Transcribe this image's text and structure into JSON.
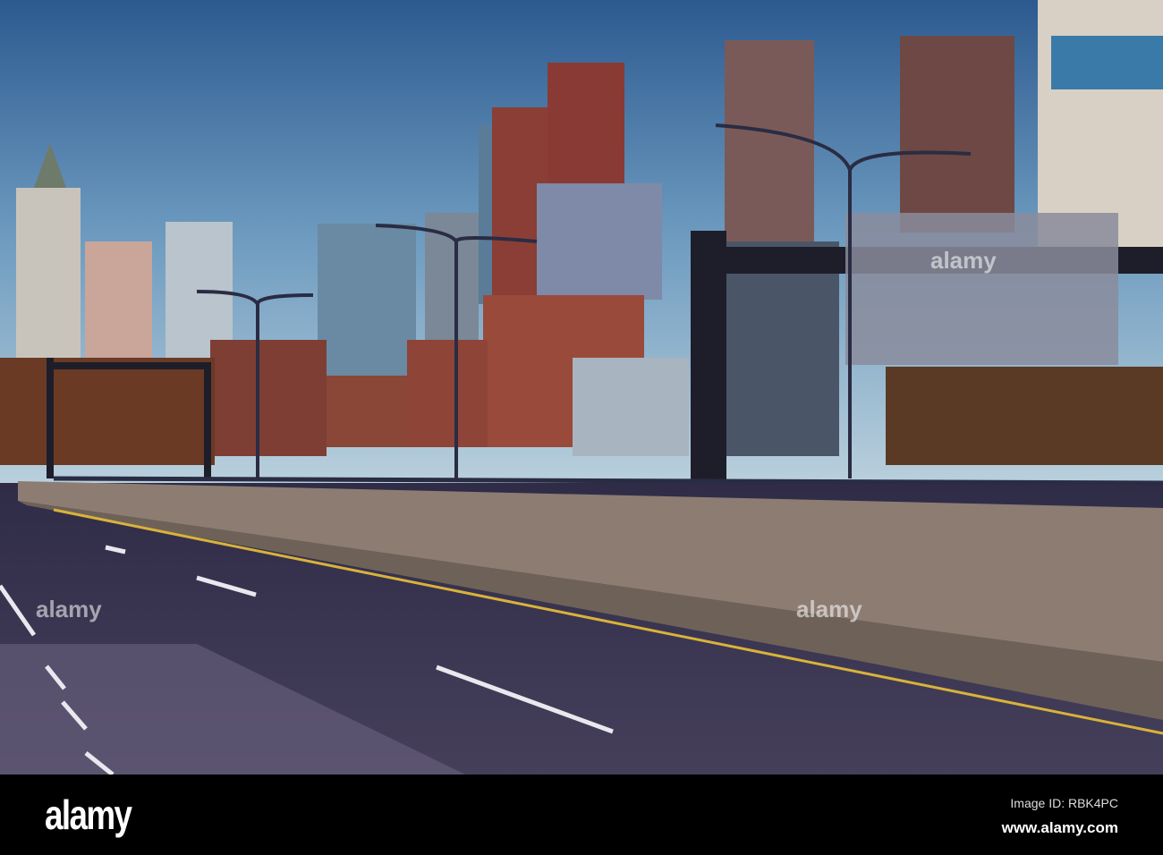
{
  "photo": {
    "subject": "city-skyline-road",
    "colors": {
      "sky_top": "#2f5f94",
      "sky_low": "#a9c4d8",
      "brick": "#9a4a3a",
      "road": "#3a3650",
      "wall": "#8c7c72",
      "lane": "#e8e8ee",
      "edge_line": "#d9b23a"
    }
  },
  "watermark": {
    "text": "alamy"
  },
  "footer": {
    "logo": "alamy",
    "image_id": "Image ID: RBK4PC",
    "site": "www.alamy.com"
  }
}
